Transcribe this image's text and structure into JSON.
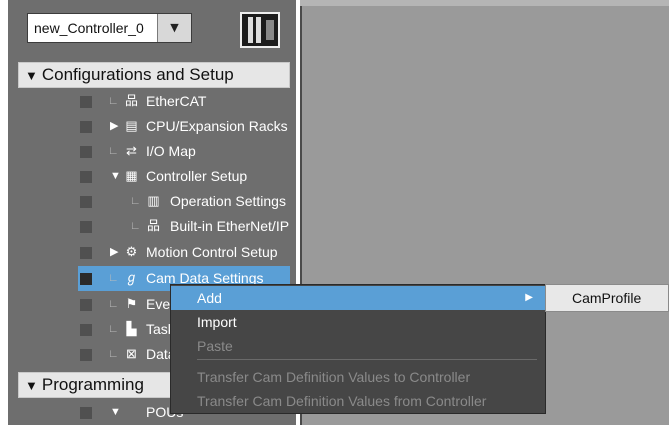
{
  "controller": {
    "name": "new_Controller_0",
    "dropdown_arrow": "▼"
  },
  "sections": {
    "config": {
      "arrow": "▼",
      "label": "Configurations and Setup"
    },
    "programming": {
      "arrow": "▼",
      "label": "Programming"
    }
  },
  "tree": [
    {
      "label": "EtherCAT",
      "icon": "network-icon",
      "glyph": "品",
      "expander": ""
    },
    {
      "label": "CPU/Expansion Racks",
      "icon": "rack-icon",
      "glyph": "▤",
      "expander": "▶"
    },
    {
      "label": "I/O Map",
      "icon": "io-map-icon",
      "glyph": "⇄",
      "expander": ""
    },
    {
      "label": "Controller Setup",
      "icon": "controller-setup-icon",
      "glyph": "▦",
      "expander": "▼"
    },
    {
      "label": "Operation Settings",
      "icon": "operation-settings-icon",
      "glyph": "▥",
      "expander": ""
    },
    {
      "label": "Built-in EtherNet/IP",
      "icon": "ethernet-icon",
      "glyph": "品",
      "expander": ""
    },
    {
      "label": "Motion Control Setup",
      "icon": "gear-icon",
      "glyph": "⚙",
      "expander": "▶"
    },
    {
      "label": "Cam Data Settings",
      "icon": "cam-icon",
      "glyph": "ℊ",
      "expander": ""
    },
    {
      "label": "Event Settings",
      "icon": "flag-icon",
      "glyph": "⚑",
      "expander": ""
    },
    {
      "label": "Task Settings",
      "icon": "task-icon",
      "glyph": "▙",
      "expander": ""
    },
    {
      "label": "Data Trace Settings",
      "icon": "trace-icon",
      "glyph": "⊠",
      "expander": ""
    },
    {
      "label": "POUs",
      "icon": "",
      "glyph": "",
      "expander": "▼"
    }
  ],
  "context_menu": {
    "items": [
      {
        "label": "Add",
        "submenu_arrow": "▶"
      },
      {
        "label": "Import"
      },
      {
        "label": "Paste"
      },
      {
        "label": "Transfer Cam Definition Values to Controller"
      },
      {
        "label": "Transfer Cam Definition Values from Controller"
      }
    ]
  },
  "submenu": {
    "items": [
      {
        "label": "CamProfile"
      }
    ]
  }
}
